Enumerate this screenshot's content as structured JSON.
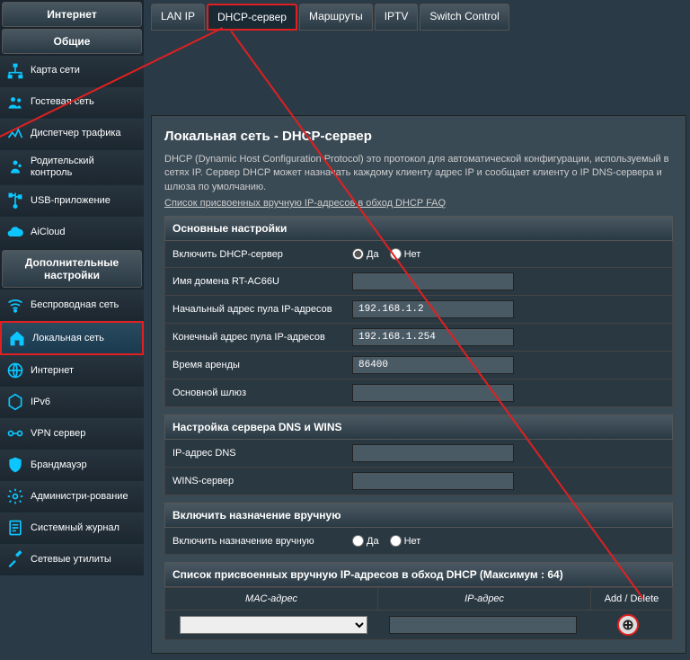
{
  "sidebar": {
    "group1_title": "Интернет",
    "group2_title": "Общие",
    "group3_title": "Дополнительные настройки",
    "items1": [],
    "items2": [
      {
        "label": "Карта сети",
        "icon": "sitemap"
      },
      {
        "label": "Гостевая сеть",
        "icon": "guest"
      },
      {
        "label": "Диспетчер трафика",
        "icon": "traffic"
      },
      {
        "label": "Родительский контроль",
        "icon": "parent"
      },
      {
        "label": "USB-приложение",
        "icon": "usb"
      },
      {
        "label": "AiCloud",
        "icon": "cloud"
      }
    ],
    "items3": [
      {
        "label": "Беспроводная сеть",
        "icon": "wifi"
      },
      {
        "label": "Локальная сеть",
        "icon": "home",
        "active": true
      },
      {
        "label": "Интернет",
        "icon": "globe"
      },
      {
        "label": "IPv6",
        "icon": "hex"
      },
      {
        "label": "VPN сервер",
        "icon": "vpn"
      },
      {
        "label": "Брандмауэр",
        "icon": "shield"
      },
      {
        "label": "Администри-рование",
        "icon": "gear"
      },
      {
        "label": "Системный журнал",
        "icon": "log"
      },
      {
        "label": "Сетевые утилиты",
        "icon": "tools"
      }
    ]
  },
  "tabs": [
    {
      "label": "LAN IP"
    },
    {
      "label": "DHCP-сервер",
      "active": true
    },
    {
      "label": "Маршруты"
    },
    {
      "label": "IPTV"
    },
    {
      "label": "Switch Control"
    }
  ],
  "page": {
    "title": "Локальная сеть - DHCP-сервер",
    "desc": "DHCP (Dynamic Host Configuration Protocol) это протокол для автоматической конфигурации, используемый в сетях IP. Сервер DHCP может назначать каждому клиенту адрес IP и сообщает клиенту о IP DNS-сервера и шлюза по умолчанию.",
    "faq_link": "Список присвоенных вручную IP-адресов в обход DHCP FAQ"
  },
  "radio": {
    "yes": "Да",
    "no": "Нет"
  },
  "sections": {
    "basic": {
      "title": "Основные настройки",
      "enable_label": "Включить DHCP-сервер",
      "domain_label": "Имя домена RT-AC66U",
      "domain_value": "",
      "start_label": "Начальный адрес пула IP-адресов",
      "start_value": "192.168.1.2",
      "end_label": "Конечный адрес пула IP-адресов",
      "end_value": "192.168.1.254",
      "lease_label": "Время аренды",
      "lease_value": "86400",
      "gateway_label": "Основной шлюз",
      "gateway_value": ""
    },
    "dns": {
      "title": "Настройка сервера DNS и WINS",
      "dns_label": "IP-адрес DNS",
      "dns_value": "",
      "wins_label": "WINS-сервер",
      "wins_value": ""
    },
    "manual": {
      "title": "Включить назначение вручную",
      "enable_label": "Включить назначение вручную"
    },
    "list": {
      "title": "Список присвоенных вручную IP-адресов в обход DHCP (Максимум : 64)",
      "col_mac": "MAC-адрес",
      "col_ip": "IP-адрес",
      "col_action": "Add / Delete"
    }
  }
}
